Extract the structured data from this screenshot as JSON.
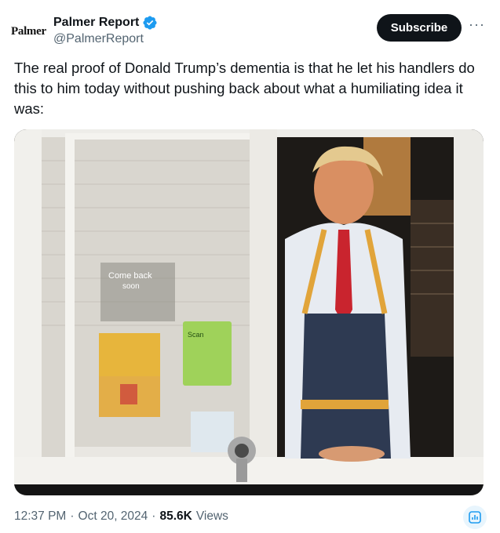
{
  "author": {
    "avatar_text": "Palmer",
    "display_name": "Palmer Report",
    "handle": "@PalmerReport",
    "verified": true
  },
  "actions": {
    "subscribe_label": "Subscribe",
    "more_icon": "more-horizontal-icon"
  },
  "tweet": {
    "text": "The real proof of Donald Trump’s dementia is that he let his handlers do this to him today without pushing back about what a humiliating idea it was:"
  },
  "media": {
    "sign_text_1": "Come back",
    "sign_text_2": "soon",
    "scan_text": "Scan",
    "description_icon": "photo"
  },
  "meta": {
    "time": "12:37 PM",
    "separator": "·",
    "date": "Oct 20, 2024",
    "views_count": "85.6K",
    "views_label": "Views"
  },
  "colors": {
    "verified": "#1d9bf0",
    "text_primary": "#0f1419",
    "text_secondary": "#536471",
    "button_bg": "#0f1419"
  }
}
